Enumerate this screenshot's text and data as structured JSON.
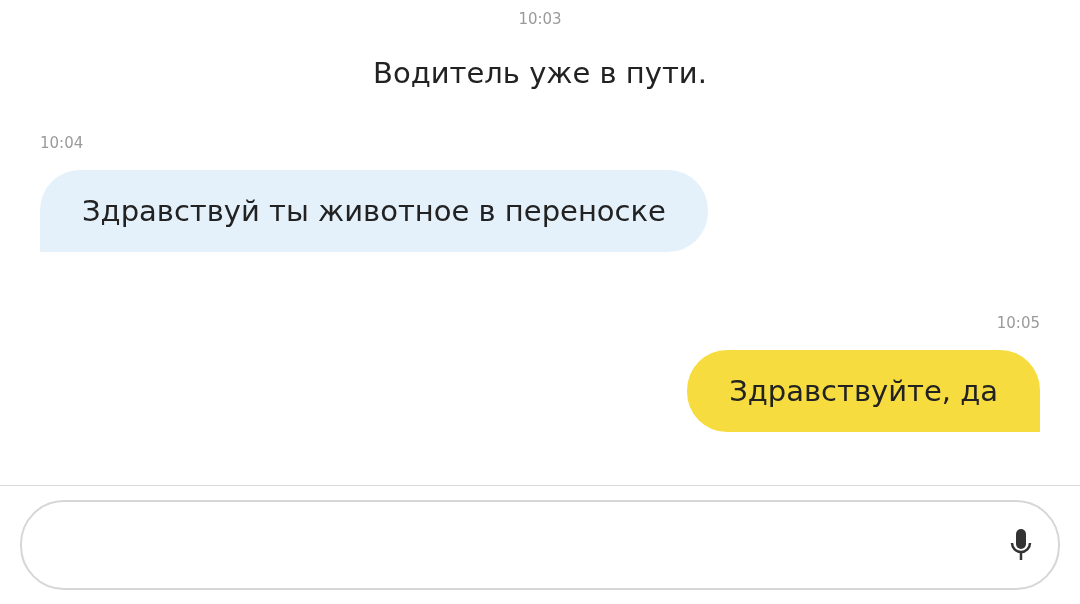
{
  "messages": [
    {
      "kind": "system",
      "time": "10:03",
      "text": "Водитель уже в пути."
    },
    {
      "kind": "incoming",
      "time": "10:04",
      "text": "Здравствуй ты животное в переноске"
    },
    {
      "kind": "outgoing",
      "time": "10:05",
      "text": "Здравствуйте, да"
    }
  ]
}
